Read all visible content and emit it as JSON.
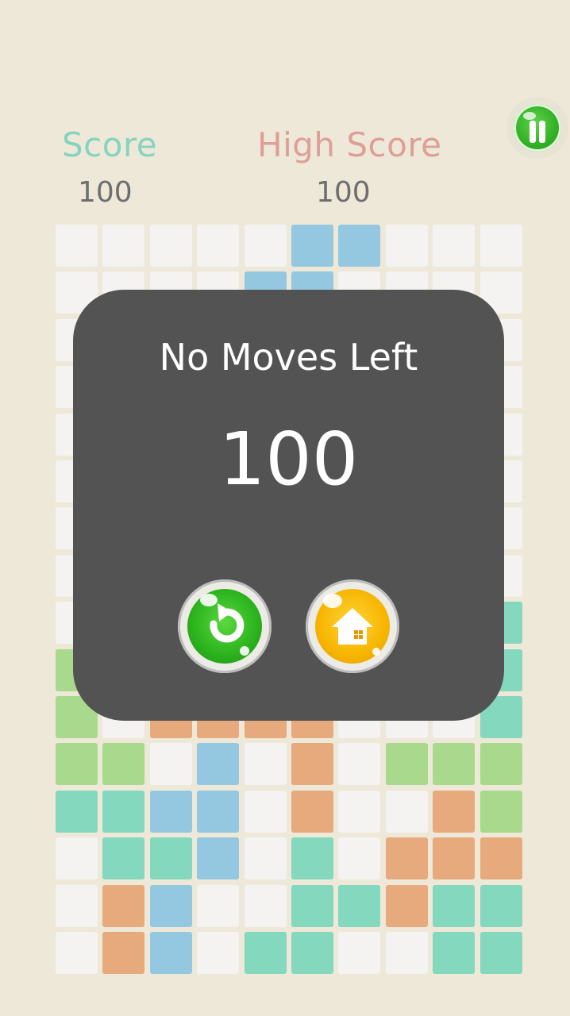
{
  "hud": {
    "score_label": "Score",
    "score_value": "100",
    "highscore_label": "High Score",
    "highscore_value": "100"
  },
  "pause_button": {
    "icon": "pause-icon",
    "color": "#2fae24"
  },
  "board": {
    "rows": 16,
    "cols": 10,
    "colors": {
      "E": "#f4f3f1",
      "B": "#93c8e0",
      "G": "#a9d98c",
      "T": "#84d8be",
      "O": "#e7aa7c"
    },
    "grid": [
      "EEEEEBBEEE",
      "EEEEBBEEEE",
      "EEEEEEEEEE",
      "EEEEEEEEEE",
      "EEEEEEEEEE",
      "EEEEEEEEEE",
      "EEEEEEEEEE",
      "EEEEEEEEEE",
      "EEEEEEEEET",
      "GEEEEEEEET",
      "GEOOOOEEET",
      "GGEBEOEGGG",
      "TTBBEOEEOG",
      "ETTBETEOOO",
      "EOBEETTOTT",
      "EOBETTEETT"
    ]
  },
  "overlay": {
    "title": "No Moves Left",
    "score": "100",
    "restart_icon": "restart-icon",
    "home_icon": "home-icon"
  }
}
